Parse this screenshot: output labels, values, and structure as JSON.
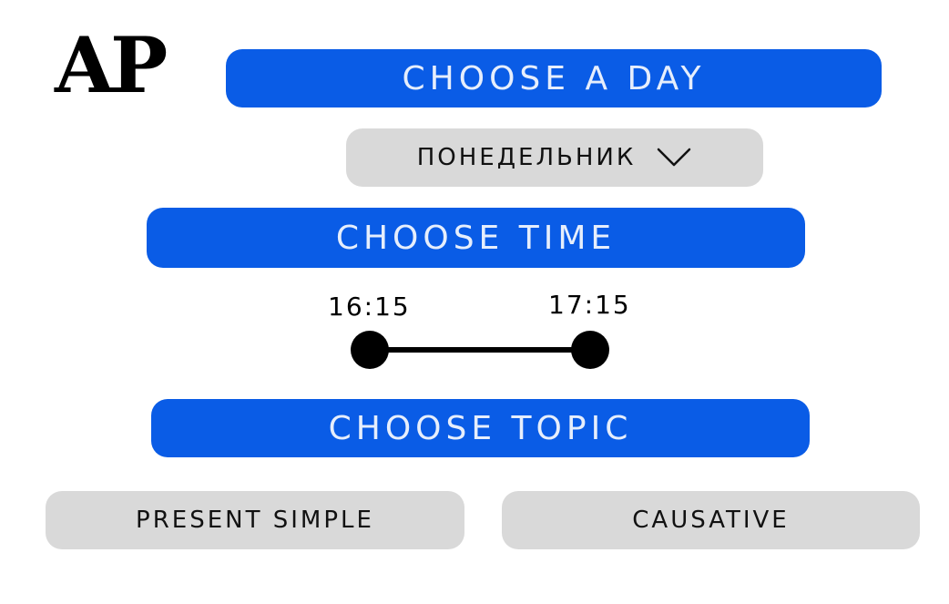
{
  "logo": {
    "text": "AP"
  },
  "day": {
    "header_label": "CHOOSE A DAY",
    "selected_value": "ПОНЕДЕЛЬНИК"
  },
  "time": {
    "header_label": "CHOOSE TIME",
    "start": "16:15",
    "end": "17:15"
  },
  "topic": {
    "header_label": "CHOOSE TOPIC",
    "options": [
      "PRESENT SIMPLE",
      "CAUSATIVE"
    ]
  },
  "colors": {
    "accent": "#0a5ce6",
    "pill_gray": "#d9d9d9",
    "slider": "#000000"
  },
  "icons": {
    "dropdown": "chevron-down-icon",
    "range_handles": "slider-handle"
  }
}
